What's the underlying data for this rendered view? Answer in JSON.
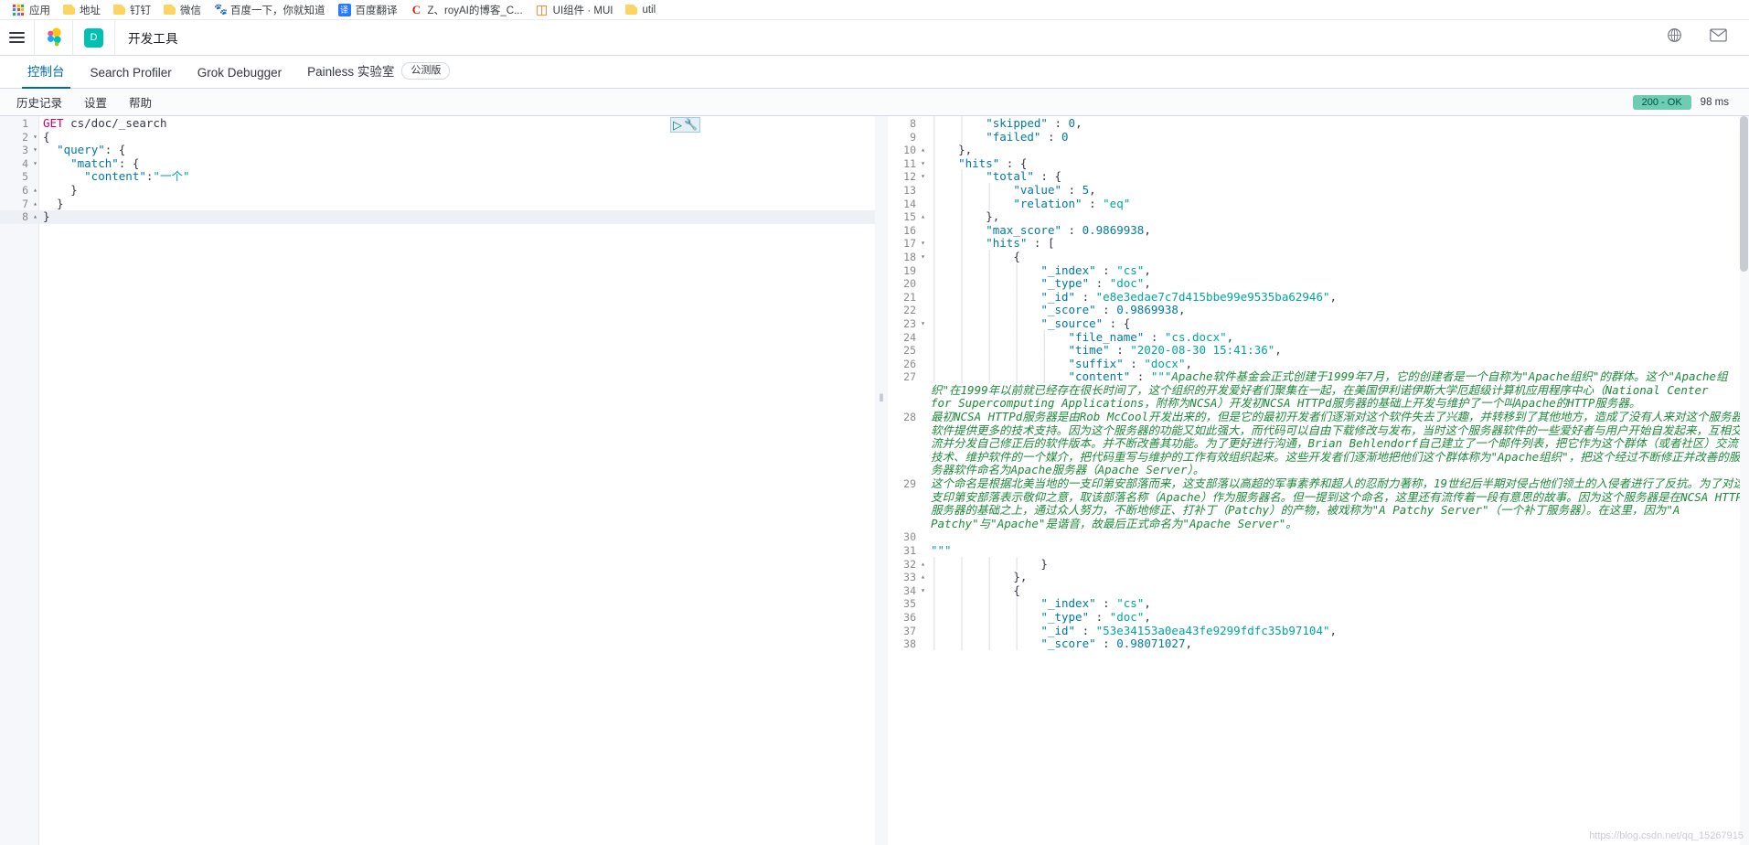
{
  "browser": {
    "bookmarks": [
      {
        "label": "应用",
        "icon": "apps-grid-icon"
      },
      {
        "label": "地址",
        "icon": "folder-icon"
      },
      {
        "label": "钉钉",
        "icon": "folder-icon"
      },
      {
        "label": "微信",
        "icon": "folder-icon"
      },
      {
        "label": "百度一下，你就知道",
        "icon": "baidu-icon"
      },
      {
        "label": "百度翻译",
        "icon": "baidu-fanyi-icon"
      },
      {
        "label": "Z、royAI的博客_C...",
        "icon": "csdn-icon"
      },
      {
        "label": "UI组件 · MUI",
        "icon": "mui-icon"
      },
      {
        "label": "util",
        "icon": "folder-icon"
      }
    ]
  },
  "topnav": {
    "menu_icon": "hamburger-menu-icon",
    "logo_icon": "elastic-logo-icon",
    "space_initial": "D",
    "app_title": "开发工具",
    "help_icon": "help-circle-icon",
    "mail_icon": "news-mail-icon"
  },
  "tabs": [
    {
      "label": "控制台",
      "active": true,
      "badge": null
    },
    {
      "label": "Search Profiler",
      "active": false,
      "badge": null
    },
    {
      "label": "Grok Debugger",
      "active": false,
      "badge": null
    },
    {
      "label": "Painless 实验室",
      "active": false,
      "badge": "公测版"
    }
  ],
  "console_bar": {
    "items": [
      "历史记录",
      "设置",
      "帮助"
    ],
    "status_code": "200 - OK",
    "elapsed": "98 ms",
    "status_color": "#6dccb1"
  },
  "editor": {
    "run_icon": "play-triangle-icon",
    "wrench_icon": "wrench-icon",
    "highlighted_line": 8,
    "lines": [
      {
        "n": 1,
        "fold": "",
        "tokens": [
          {
            "t": "GET ",
            "c": "c-method"
          },
          {
            "t": "cs/doc/_search",
            "c": "c-url"
          }
        ]
      },
      {
        "n": 2,
        "fold": "▾",
        "tokens": [
          {
            "t": "{",
            "c": "c-punc"
          }
        ]
      },
      {
        "n": 3,
        "fold": "▾",
        "tokens": [
          {
            "t": "  ",
            "c": "c-punc"
          },
          {
            "t": "\"query\"",
            "c": "c-key"
          },
          {
            "t": ": {",
            "c": "c-punc"
          }
        ]
      },
      {
        "n": 4,
        "fold": "▾",
        "tokens": [
          {
            "t": "    ",
            "c": "c-punc"
          },
          {
            "t": "\"match\"",
            "c": "c-key"
          },
          {
            "t": ": {",
            "c": "c-punc"
          }
        ]
      },
      {
        "n": 5,
        "fold": "",
        "tokens": [
          {
            "t": "      ",
            "c": "c-punc"
          },
          {
            "t": "\"content\"",
            "c": "c-key"
          },
          {
            "t": ":",
            "c": "c-punc"
          },
          {
            "t": "\"一个\"",
            "c": "c-str"
          }
        ]
      },
      {
        "n": 6,
        "fold": "▴",
        "tokens": [
          {
            "t": "    }",
            "c": "c-punc"
          }
        ]
      },
      {
        "n": 7,
        "fold": "▴",
        "tokens": [
          {
            "t": "  }",
            "c": "c-punc"
          }
        ]
      },
      {
        "n": 8,
        "fold": "▴",
        "tokens": [
          {
            "t": "}",
            "c": "c-punc"
          }
        ]
      }
    ]
  },
  "response": {
    "lines": [
      {
        "n": 8,
        "fold": "",
        "indent": 2,
        "tokens": [
          {
            "t": "\"skipped\"",
            "c": "c-key"
          },
          {
            "t": " : ",
            "c": "c-punc"
          },
          {
            "t": "0",
            "c": "c-num"
          },
          {
            "t": ",",
            "c": "c-punc"
          }
        ]
      },
      {
        "n": 9,
        "fold": "",
        "indent": 2,
        "tokens": [
          {
            "t": "\"failed\"",
            "c": "c-key"
          },
          {
            "t": " : ",
            "c": "c-punc"
          },
          {
            "t": "0",
            "c": "c-num"
          }
        ]
      },
      {
        "n": 10,
        "fold": "▴",
        "indent": 1,
        "tokens": [
          {
            "t": "},",
            "c": "c-punc"
          }
        ]
      },
      {
        "n": 11,
        "fold": "▾",
        "indent": 1,
        "tokens": [
          {
            "t": "\"hits\"",
            "c": "c-key"
          },
          {
            "t": " : {",
            "c": "c-punc"
          }
        ]
      },
      {
        "n": 12,
        "fold": "▾",
        "indent": 2,
        "tokens": [
          {
            "t": "\"total\"",
            "c": "c-key"
          },
          {
            "t": " : {",
            "c": "c-punc"
          }
        ]
      },
      {
        "n": 13,
        "fold": "",
        "indent": 3,
        "tokens": [
          {
            "t": "\"value\"",
            "c": "c-key"
          },
          {
            "t": " : ",
            "c": "c-punc"
          },
          {
            "t": "5",
            "c": "c-num"
          },
          {
            "t": ",",
            "c": "c-punc"
          }
        ]
      },
      {
        "n": 14,
        "fold": "",
        "indent": 3,
        "tokens": [
          {
            "t": "\"relation\"",
            "c": "c-key"
          },
          {
            "t": " : ",
            "c": "c-punc"
          },
          {
            "t": "\"eq\"",
            "c": "c-str"
          }
        ]
      },
      {
        "n": 15,
        "fold": "▴",
        "indent": 2,
        "tokens": [
          {
            "t": "},",
            "c": "c-punc"
          }
        ]
      },
      {
        "n": 16,
        "fold": "",
        "indent": 2,
        "tokens": [
          {
            "t": "\"max_score\"",
            "c": "c-key"
          },
          {
            "t": " : ",
            "c": "c-punc"
          },
          {
            "t": "0.9869938",
            "c": "c-num"
          },
          {
            "t": ",",
            "c": "c-punc"
          }
        ]
      },
      {
        "n": 17,
        "fold": "▾",
        "indent": 2,
        "tokens": [
          {
            "t": "\"hits\"",
            "c": "c-key"
          },
          {
            "t": " : [",
            "c": "c-punc"
          }
        ]
      },
      {
        "n": 18,
        "fold": "▾",
        "indent": 3,
        "tokens": [
          {
            "t": "{",
            "c": "c-punc"
          }
        ]
      },
      {
        "n": 19,
        "fold": "",
        "indent": 4,
        "tokens": [
          {
            "t": "\"_index\"",
            "c": "c-key"
          },
          {
            "t": " : ",
            "c": "c-punc"
          },
          {
            "t": "\"cs\"",
            "c": "c-str"
          },
          {
            "t": ",",
            "c": "c-punc"
          }
        ]
      },
      {
        "n": 20,
        "fold": "",
        "indent": 4,
        "tokens": [
          {
            "t": "\"_type\"",
            "c": "c-key"
          },
          {
            "t": " : ",
            "c": "c-punc"
          },
          {
            "t": "\"doc\"",
            "c": "c-str"
          },
          {
            "t": ",",
            "c": "c-punc"
          }
        ]
      },
      {
        "n": 21,
        "fold": "",
        "indent": 4,
        "tokens": [
          {
            "t": "\"_id\"",
            "c": "c-key"
          },
          {
            "t": " : ",
            "c": "c-punc"
          },
          {
            "t": "\"e8e3edae7c7d415bbe99e9535ba62946\"",
            "c": "c-str"
          },
          {
            "t": ",",
            "c": "c-punc"
          }
        ]
      },
      {
        "n": 22,
        "fold": "",
        "indent": 4,
        "tokens": [
          {
            "t": "\"_score\"",
            "c": "c-key"
          },
          {
            "t": " : ",
            "c": "c-punc"
          },
          {
            "t": "0.9869938",
            "c": "c-num"
          },
          {
            "t": ",",
            "c": "c-punc"
          }
        ]
      },
      {
        "n": 23,
        "fold": "▾",
        "indent": 4,
        "tokens": [
          {
            "t": "\"_source\"",
            "c": "c-key"
          },
          {
            "t": " : {",
            "c": "c-punc"
          }
        ]
      },
      {
        "n": 24,
        "fold": "",
        "indent": 5,
        "tokens": [
          {
            "t": "\"file_name\"",
            "c": "c-key"
          },
          {
            "t": " : ",
            "c": "c-punc"
          },
          {
            "t": "\"cs.docx\"",
            "c": "c-str"
          },
          {
            "t": ",",
            "c": "c-punc"
          }
        ]
      },
      {
        "n": 25,
        "fold": "",
        "indent": 5,
        "tokens": [
          {
            "t": "\"time\"",
            "c": "c-key"
          },
          {
            "t": " : ",
            "c": "c-punc"
          },
          {
            "t": "\"2020-08-30 15:41:36\"",
            "c": "c-str"
          },
          {
            "t": ",",
            "c": "c-punc"
          }
        ]
      },
      {
        "n": 26,
        "fold": "",
        "indent": 5,
        "tokens": [
          {
            "t": "\"suffix\"",
            "c": "c-key"
          },
          {
            "t": " : ",
            "c": "c-punc"
          },
          {
            "t": "\"docx\"",
            "c": "c-str"
          },
          {
            "t": ",",
            "c": "c-punc"
          }
        ]
      }
    ],
    "content_line": {
      "n": 27,
      "key": "\"content\"",
      "sep": " : ",
      "quote": "\"\"\"",
      "text": "Apache软件基金会正式创建于1999年7月，它的创建者是一个自称为\"Apache组织\"的群体。这个\"Apache组织\"在1999年以前就已经存在很长时间了，这个组织的开发爱好者们聚集在一起，在美国伊利诺伊斯大学厄超级计算机应用程序中心（National Center for Supercomputing Applications，附称为NCSA）开发初NCSA HTTPd服务器的基础上开发与维护了一个叫Apache的HTTP服务器。"
    },
    "paragraphs": [
      {
        "n": 28,
        "text": "最初NCSA HTTPd服务器是由Rob McCool开发出来的，但是它的最初开发者们逐渐对这个软件失去了兴趣，并转移到了其他地方，造成了没有人来对这个服务器软件提供更多的技术支持。因为这个服务器的功能又如此强大，而代码可以自由下载修改与发布，当时这个服务器软件的一些爱好者与用户开始自发起来，互相交流并分发自己修正后的软件版本。并不断改善其功能。为了更好进行沟通，Brian Behlendorf自己建立了一个邮件列表，把它作为这个群体（或者社区）交流技术、维护软件的一个媒介，把代码重写与维护的工作有效组织起来。这些开发者们逐渐地把他们这个群体称为\"Apache组织\"，把这个经过不断修正并改善的服务器软件命名为Apache服务器（Apache Server）。"
      },
      {
        "n": 29,
        "text": "这个命名是根据北美当地的一支印第安部落而来，这支部落以高超的军事素养和超人的忍耐力著称，19世纪后半期对侵占他们领土的入侵者进行了反抗。为了对这支印第安部落表示敬仰之意，取该部落名称（Apache）作为服务器名。但一提到这个命名，这里还有流传着一段有意思的故事。因为这个服务器是在NCSA HTTP服务器的基础之上，通过众人努力，不断地修正、打补丁（Patchy）的产物，被戏称为\"A Patchy Server\"（一个补丁服务器）。在这里，因为\"A Patchy\"与\"Apache\"是谐音，故最后正式命名为\"Apache Server\"。"
      }
    ],
    "tail_lines": [
      {
        "n": 30,
        "fold": "",
        "indent": 0,
        "tokens": []
      },
      {
        "n": 31,
        "fold": "",
        "indent": 0,
        "tokens": [
          {
            "t": "\"\"\"",
            "c": "c-str"
          }
        ]
      },
      {
        "n": 32,
        "fold": "▴",
        "indent": 4,
        "tokens": [
          {
            "t": "}",
            "c": "c-punc"
          }
        ]
      },
      {
        "n": 33,
        "fold": "▴",
        "indent": 3,
        "tokens": [
          {
            "t": "},",
            "c": "c-punc"
          }
        ]
      },
      {
        "n": 34,
        "fold": "▾",
        "indent": 3,
        "tokens": [
          {
            "t": "{",
            "c": "c-punc"
          }
        ]
      },
      {
        "n": 35,
        "fold": "",
        "indent": 4,
        "tokens": [
          {
            "t": "\"_index\"",
            "c": "c-key"
          },
          {
            "t": " : ",
            "c": "c-punc"
          },
          {
            "t": "\"cs\"",
            "c": "c-str"
          },
          {
            "t": ",",
            "c": "c-punc"
          }
        ]
      },
      {
        "n": 36,
        "fold": "",
        "indent": 4,
        "tokens": [
          {
            "t": "\"_type\"",
            "c": "c-key"
          },
          {
            "t": " : ",
            "c": "c-punc"
          },
          {
            "t": "\"doc\"",
            "c": "c-str"
          },
          {
            "t": ",",
            "c": "c-punc"
          }
        ]
      },
      {
        "n": 37,
        "fold": "",
        "indent": 4,
        "tokens": [
          {
            "t": "\"_id\"",
            "c": "c-key"
          },
          {
            "t": " : ",
            "c": "c-punc"
          },
          {
            "t": "\"53e34153a0ea43fe9299fdfc35b97104\"",
            "c": "c-str"
          },
          {
            "t": ",",
            "c": "c-punc"
          }
        ]
      },
      {
        "n": 38,
        "fold": "",
        "indent": 4,
        "tokens": [
          {
            "t": "\"_score\"",
            "c": "c-key"
          },
          {
            "t": " : ",
            "c": "c-punc"
          },
          {
            "t": "0.98071027",
            "c": "c-num"
          },
          {
            "t": ",",
            "c": "c-punc"
          }
        ]
      }
    ],
    "watermark": "https://blog.csdn.net/qq_15267915"
  }
}
